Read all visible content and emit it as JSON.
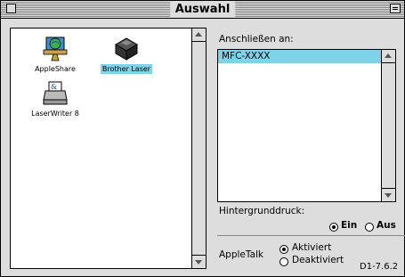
{
  "window": {
    "title": "Auswahl"
  },
  "devices": [
    {
      "label": "AppleShare",
      "icon": "appleshare-icon",
      "selected": false
    },
    {
      "label": "Brother Laser",
      "icon": "printer-icon",
      "selected": true
    },
    {
      "label": "LaserWriter 8",
      "icon": "laserwriter-icon",
      "selected": false
    }
  ],
  "connect": {
    "label": "Anschließen an:",
    "items": [
      "MFC-XXXX"
    ],
    "selected": "MFC-XXXX"
  },
  "background_printing": {
    "label": "Hintergrunddruck:",
    "options": [
      {
        "label": "Ein",
        "selected": true
      },
      {
        "label": "Aus",
        "selected": false
      }
    ]
  },
  "appletalk": {
    "label": "AppleTalk",
    "options": [
      {
        "label": "Aktiviert",
        "selected": true
      },
      {
        "label": "Deaktiviert",
        "selected": false
      }
    ]
  },
  "version": "D1-7.6.2",
  "colors": {
    "selection": "#7fd3e8",
    "window_bg": "#dddddd"
  }
}
